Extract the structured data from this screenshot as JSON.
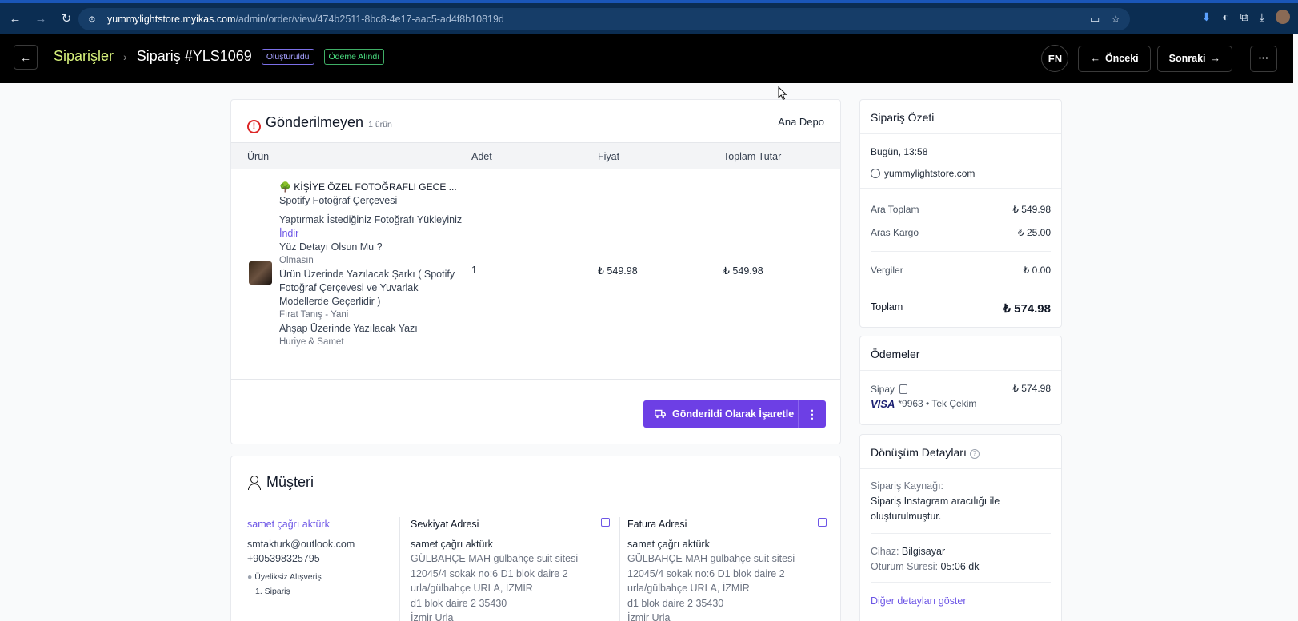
{
  "browser": {
    "url_host": "yummylightstore.myikas.com",
    "url_path": "/admin/order/view/474b2511-8bc8-4e17-aac5-ad4f8b10819d",
    "ext_badge": "1"
  },
  "header": {
    "breadcrumb_link": "Siparişler",
    "breadcrumb_sep": "›",
    "order_title": "Sipariş #YLS1069",
    "badge_created": "Oluşturuldu",
    "badge_paid": "Ödeme Alındı",
    "user_initials": "FN",
    "prev_label": "Önceki",
    "next_label": "Sonraki",
    "more_label": "···",
    "back_icon": "←",
    "prev_icon": "←",
    "next_icon": "→"
  },
  "unsent": {
    "title": "Gönderilmeyen",
    "count": "1 ürün",
    "warehouse": "Ana Depo",
    "columns": [
      "Ürün",
      "Adet",
      "Fiyat",
      "Toplam Tutar"
    ],
    "product": {
      "name": "🌳 KİŞİYE ÖZEL FOTOĞRAFLI GECE ...",
      "variant": "Spotify Fotoğraf Çerçevesi",
      "opt1_q": "Yaptırmak İstediğiniz Fotoğrafı Yükleyiniz",
      "opt1_a": "İndir",
      "opt2_q": "Yüz Detayı Olsun Mu ?",
      "opt2_a": "Olmasın",
      "opt3_q": "Ürün Üzerinde Yazılacak Şarkı ( Spotify Fotoğraf Çerçevesi ve Yuvarlak Modellerde Geçerlidir )",
      "opt3_a": "Fırat Tanış - Yani",
      "opt4_q": "Ahşap Üzerinde Yazılacak Yazı",
      "opt4_a": "Huriye & Samet",
      "quantity": "1",
      "price": "₺ 549.98",
      "total": "₺ 549.98"
    },
    "ship_button": "Gönderildi Olarak İşaretle",
    "ship_more": "⋮"
  },
  "customer": {
    "title": "Müşteri",
    "name": "samet çağrı aktürk",
    "email": "smtakturk@outlook.com",
    "phone": "+905398325795",
    "guest_label": "Üyeliksiz Alışveriş",
    "order_count": "1. Sipariş",
    "shipping": {
      "title": "Sevkiyat Adresi",
      "name": "samet çağrı aktürk",
      "line1": "GÜLBAHÇE MAH gülbahçe suit sitesi",
      "line2": "12045/4 sokak no:6 D1 blok daire 2",
      "line3": "urla/gülbahçe URLA, İZMİR",
      "line4": "d1 blok daire 2 35430",
      "line5": "İzmir Urla"
    },
    "billing": {
      "title": "Fatura Adresi",
      "name": "samet çağrı aktürk",
      "line1": "GÜLBAHÇE MAH gülbahçe suit sitesi",
      "line2": "12045/4 sokak no:6 D1 blok daire 2",
      "line3": "urla/gülbahçe URLA, İZMİR",
      "line4": "d1 blok daire 2 35430",
      "line5": "İzmir Urla"
    }
  },
  "summary": {
    "title": "Sipariş Özeti",
    "date": "Bugün, 13:58",
    "store": "yummylightstore.com",
    "subtotal_label": "Ara Toplam",
    "subtotal": "₺ 549.98",
    "shipping_label": "Aras Kargo",
    "shipping": "₺ 25.00",
    "tax_label": "Vergiler",
    "tax": "₺ 0.00",
    "total_label": "Toplam",
    "total": "₺ 574.98"
  },
  "payments": {
    "title": "Ödemeler",
    "provider": "Sipay",
    "amount": "₺ 574.98",
    "card_brand": "VISA",
    "card_detail": "*9963 • Tek Çekim"
  },
  "conversion": {
    "title": "Dönüşüm Detayları",
    "source_label": "Sipariş Kaynağı:",
    "source_value": "Sipariş Instagram aracılığı ile oluşturulmuştur.",
    "device_label": "Cihaz:",
    "device_value": "Bilgisayar",
    "session_label": "Oturum Süresi:",
    "session_value": "05:06 dk",
    "more_link": "Diğer detayları göster"
  }
}
